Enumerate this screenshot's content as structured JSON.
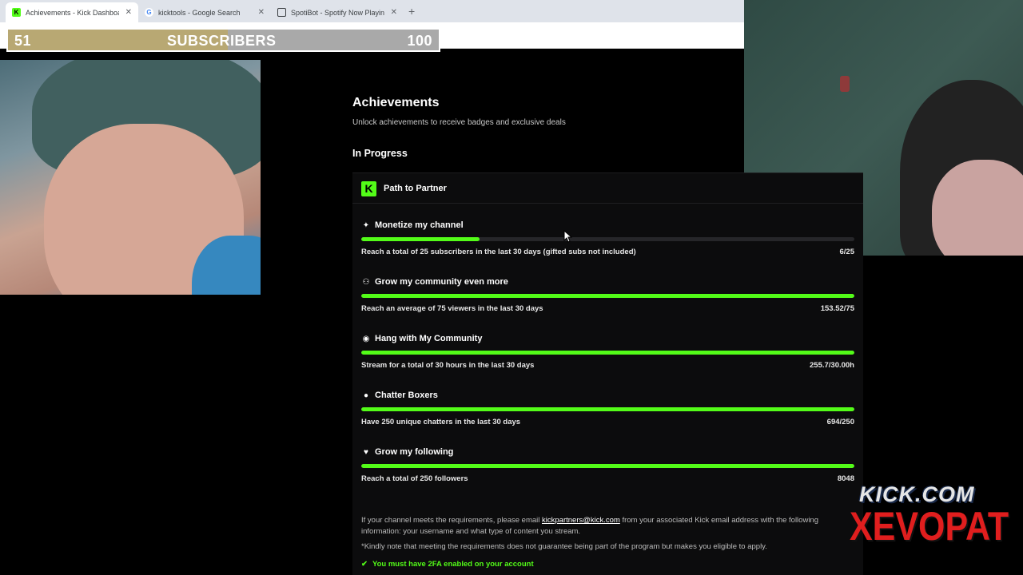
{
  "browser": {
    "tabs": [
      {
        "title": "Achievements - Kick Dashboard",
        "active": true,
        "favicon": "kick-icon",
        "favicon_color": "#53fc18"
      },
      {
        "title": "kicktools - Google Search",
        "active": false,
        "favicon": "google-icon"
      },
      {
        "title": "SpotiBot - Spotify Now Playing",
        "active": false,
        "favicon": "grid-icon"
      }
    ],
    "close_glyph": "✕",
    "new_tab_glyph": "+"
  },
  "overlay": {
    "current": "51",
    "label": "SUBSCRIBERS",
    "goal": "100",
    "progress_fraction": 0.51
  },
  "page": {
    "title": "Achievements",
    "subtitle": "Unlock achievements to receive badges and exclusive deals",
    "section": "In Progress"
  },
  "card": {
    "logo_glyph": "K",
    "title": "Path to Partner",
    "achievements": [
      {
        "icon": "sparkle-icon",
        "glyph": "✦",
        "name": "Monetize my channel",
        "description": "Reach a total of 25 subscribers in the last 30 days (gifted subs not included)",
        "value": "6/25",
        "progress": 0.24
      },
      {
        "icon": "community-icon",
        "glyph": "⚇",
        "name": "Grow my community even more",
        "description": "Reach an average of 75 viewers in the last 30 days",
        "value": "153.52/75",
        "progress": 1.0
      },
      {
        "icon": "broadcast-icon",
        "glyph": "◉",
        "name": "Hang with My Community",
        "description": "Stream for a total of 30 hours in the last 30 days",
        "value": "255.7/30.00h",
        "progress": 1.0
      },
      {
        "icon": "chat-icon",
        "glyph": "●",
        "name": "Chatter Boxers",
        "description": "Have 250 unique chatters in the last 30 days",
        "value": "694/250",
        "progress": 1.0
      },
      {
        "icon": "heart-icon",
        "glyph": "♥",
        "name": "Grow my following",
        "description": "Reach a total of 250 followers",
        "value": "8048",
        "progress": 1.0
      }
    ],
    "info_prefix": "If your channel meets the requirements, please email ",
    "info_email": "kickpartners@kick.com",
    "info_suffix": " from your associated Kick email address with the following information: your username and what type of content you stream.",
    "note": "*Kindly note that meeting the requirements does not guarantee being part of the program but makes you eligible to apply.",
    "requirement": "You must have 2FA enabled on your account",
    "requirement_glyph": "✔"
  },
  "branding": {
    "line1": "KICK.COM",
    "line2": "XEVOPAT"
  },
  "colors": {
    "accent": "#53fc18",
    "background": "#000000",
    "card": "#0c0c0d"
  }
}
